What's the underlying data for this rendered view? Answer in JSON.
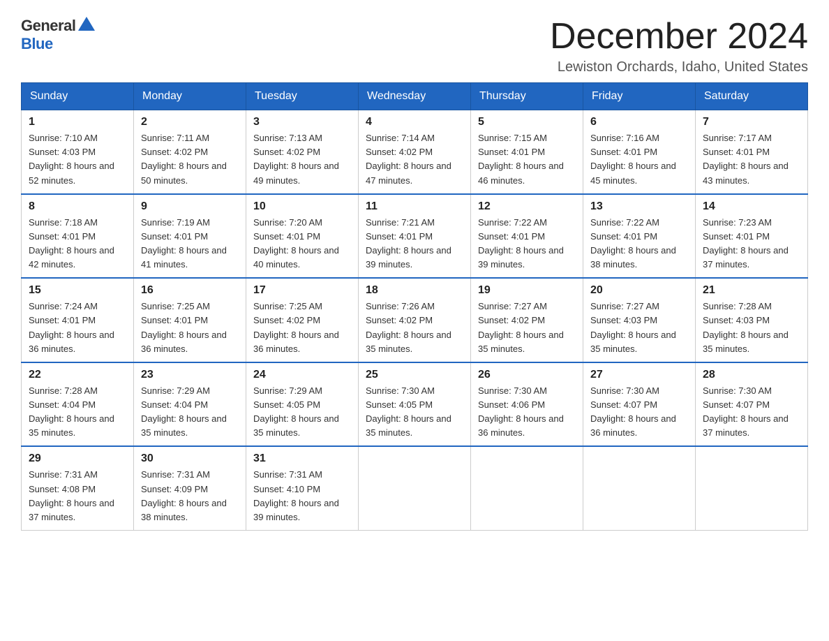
{
  "header": {
    "logo_general": "General",
    "logo_blue": "Blue",
    "month_title": "December 2024",
    "location": "Lewiston Orchards, Idaho, United States"
  },
  "weekdays": [
    "Sunday",
    "Monday",
    "Tuesday",
    "Wednesday",
    "Thursday",
    "Friday",
    "Saturday"
  ],
  "weeks": [
    [
      {
        "day": "1",
        "sunrise": "7:10 AM",
        "sunset": "4:03 PM",
        "daylight": "8 hours and 52 minutes."
      },
      {
        "day": "2",
        "sunrise": "7:11 AM",
        "sunset": "4:02 PM",
        "daylight": "8 hours and 50 minutes."
      },
      {
        "day": "3",
        "sunrise": "7:13 AM",
        "sunset": "4:02 PM",
        "daylight": "8 hours and 49 minutes."
      },
      {
        "day": "4",
        "sunrise": "7:14 AM",
        "sunset": "4:02 PM",
        "daylight": "8 hours and 47 minutes."
      },
      {
        "day": "5",
        "sunrise": "7:15 AM",
        "sunset": "4:01 PM",
        "daylight": "8 hours and 46 minutes."
      },
      {
        "day": "6",
        "sunrise": "7:16 AM",
        "sunset": "4:01 PM",
        "daylight": "8 hours and 45 minutes."
      },
      {
        "day": "7",
        "sunrise": "7:17 AM",
        "sunset": "4:01 PM",
        "daylight": "8 hours and 43 minutes."
      }
    ],
    [
      {
        "day": "8",
        "sunrise": "7:18 AM",
        "sunset": "4:01 PM",
        "daylight": "8 hours and 42 minutes."
      },
      {
        "day": "9",
        "sunrise": "7:19 AM",
        "sunset": "4:01 PM",
        "daylight": "8 hours and 41 minutes."
      },
      {
        "day": "10",
        "sunrise": "7:20 AM",
        "sunset": "4:01 PM",
        "daylight": "8 hours and 40 minutes."
      },
      {
        "day": "11",
        "sunrise": "7:21 AM",
        "sunset": "4:01 PM",
        "daylight": "8 hours and 39 minutes."
      },
      {
        "day": "12",
        "sunrise": "7:22 AM",
        "sunset": "4:01 PM",
        "daylight": "8 hours and 39 minutes."
      },
      {
        "day": "13",
        "sunrise": "7:22 AM",
        "sunset": "4:01 PM",
        "daylight": "8 hours and 38 minutes."
      },
      {
        "day": "14",
        "sunrise": "7:23 AM",
        "sunset": "4:01 PM",
        "daylight": "8 hours and 37 minutes."
      }
    ],
    [
      {
        "day": "15",
        "sunrise": "7:24 AM",
        "sunset": "4:01 PM",
        "daylight": "8 hours and 36 minutes."
      },
      {
        "day": "16",
        "sunrise": "7:25 AM",
        "sunset": "4:01 PM",
        "daylight": "8 hours and 36 minutes."
      },
      {
        "day": "17",
        "sunrise": "7:25 AM",
        "sunset": "4:02 PM",
        "daylight": "8 hours and 36 minutes."
      },
      {
        "day": "18",
        "sunrise": "7:26 AM",
        "sunset": "4:02 PM",
        "daylight": "8 hours and 35 minutes."
      },
      {
        "day": "19",
        "sunrise": "7:27 AM",
        "sunset": "4:02 PM",
        "daylight": "8 hours and 35 minutes."
      },
      {
        "day": "20",
        "sunrise": "7:27 AM",
        "sunset": "4:03 PM",
        "daylight": "8 hours and 35 minutes."
      },
      {
        "day": "21",
        "sunrise": "7:28 AM",
        "sunset": "4:03 PM",
        "daylight": "8 hours and 35 minutes."
      }
    ],
    [
      {
        "day": "22",
        "sunrise": "7:28 AM",
        "sunset": "4:04 PM",
        "daylight": "8 hours and 35 minutes."
      },
      {
        "day": "23",
        "sunrise": "7:29 AM",
        "sunset": "4:04 PM",
        "daylight": "8 hours and 35 minutes."
      },
      {
        "day": "24",
        "sunrise": "7:29 AM",
        "sunset": "4:05 PM",
        "daylight": "8 hours and 35 minutes."
      },
      {
        "day": "25",
        "sunrise": "7:30 AM",
        "sunset": "4:05 PM",
        "daylight": "8 hours and 35 minutes."
      },
      {
        "day": "26",
        "sunrise": "7:30 AM",
        "sunset": "4:06 PM",
        "daylight": "8 hours and 36 minutes."
      },
      {
        "day": "27",
        "sunrise": "7:30 AM",
        "sunset": "4:07 PM",
        "daylight": "8 hours and 36 minutes."
      },
      {
        "day": "28",
        "sunrise": "7:30 AM",
        "sunset": "4:07 PM",
        "daylight": "8 hours and 37 minutes."
      }
    ],
    [
      {
        "day": "29",
        "sunrise": "7:31 AM",
        "sunset": "4:08 PM",
        "daylight": "8 hours and 37 minutes."
      },
      {
        "day": "30",
        "sunrise": "7:31 AM",
        "sunset": "4:09 PM",
        "daylight": "8 hours and 38 minutes."
      },
      {
        "day": "31",
        "sunrise": "7:31 AM",
        "sunset": "4:10 PM",
        "daylight": "8 hours and 39 minutes."
      },
      null,
      null,
      null,
      null
    ]
  ]
}
